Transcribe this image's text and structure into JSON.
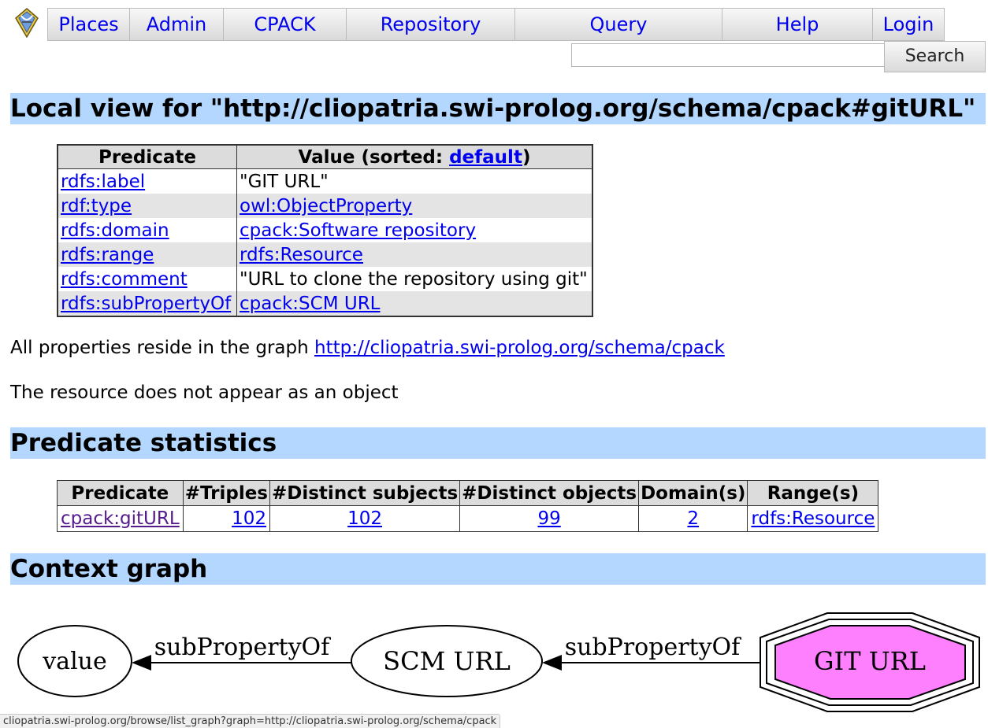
{
  "menu": {
    "items": [
      {
        "label": "Places"
      },
      {
        "label": "Admin"
      },
      {
        "label": "CPACK"
      },
      {
        "label": "Repository"
      },
      {
        "label": "Query"
      },
      {
        "label": "Help"
      },
      {
        "label": "Login"
      }
    ]
  },
  "search": {
    "value": "",
    "button_label": "Search"
  },
  "local_view": {
    "title": "Local view for \"http://cliopatria.swi-prolog.org/schema/cpack#gitURL\"",
    "header_predicate": "Predicate",
    "header_value_prefix": "Value (sorted: ",
    "header_value_link": "default",
    "header_value_suffix": ")",
    "rows": [
      {
        "predicate": "rdfs:label",
        "value": "\"GIT URL\"",
        "value_is_link": false
      },
      {
        "predicate": "rdf:type",
        "value": "owl:ObjectProperty",
        "value_is_link": true
      },
      {
        "predicate": "rdfs:domain",
        "value": "cpack:Software repository",
        "value_is_link": true
      },
      {
        "predicate": "rdfs:range",
        "value": "rdfs:Resource",
        "value_is_link": true
      },
      {
        "predicate": "rdfs:comment",
        "value": "\"URL to clone the repository using git\"",
        "value_is_link": false
      },
      {
        "predicate": "rdfs:subPropertyOf",
        "value": "cpack:SCM URL",
        "value_is_link": true
      }
    ]
  },
  "graph_note": {
    "prefix": "All properties reside in the graph ",
    "link": "http://cliopatria.swi-prolog.org/schema/cpack"
  },
  "object_note": "The resource does not appear as an object",
  "predicate_statistics": {
    "title": "Predicate statistics",
    "headers": [
      "Predicate",
      "#Triples",
      "#Distinct subjects",
      "#Distinct objects",
      "Domain(s)",
      "Range(s)"
    ],
    "row": {
      "predicate": "cpack:gitURL",
      "triples": "102",
      "distinct_subjects": "102",
      "distinct_objects": "99",
      "domains": "2",
      "ranges": "rdfs:Resource"
    }
  },
  "context_graph": {
    "title": "Context graph",
    "nodes": {
      "value": "value",
      "scm": "SCM URL",
      "git": "GIT URL"
    },
    "edge_label_1": "subPropertyOf",
    "edge_label_2": "subPropertyOf",
    "git_fill": "#ff80ff"
  },
  "status_bar": "cliopatria.swi-prolog.org/browse/list_graph?graph=http://cliopatria.swi-prolog.org/schema/cpack"
}
